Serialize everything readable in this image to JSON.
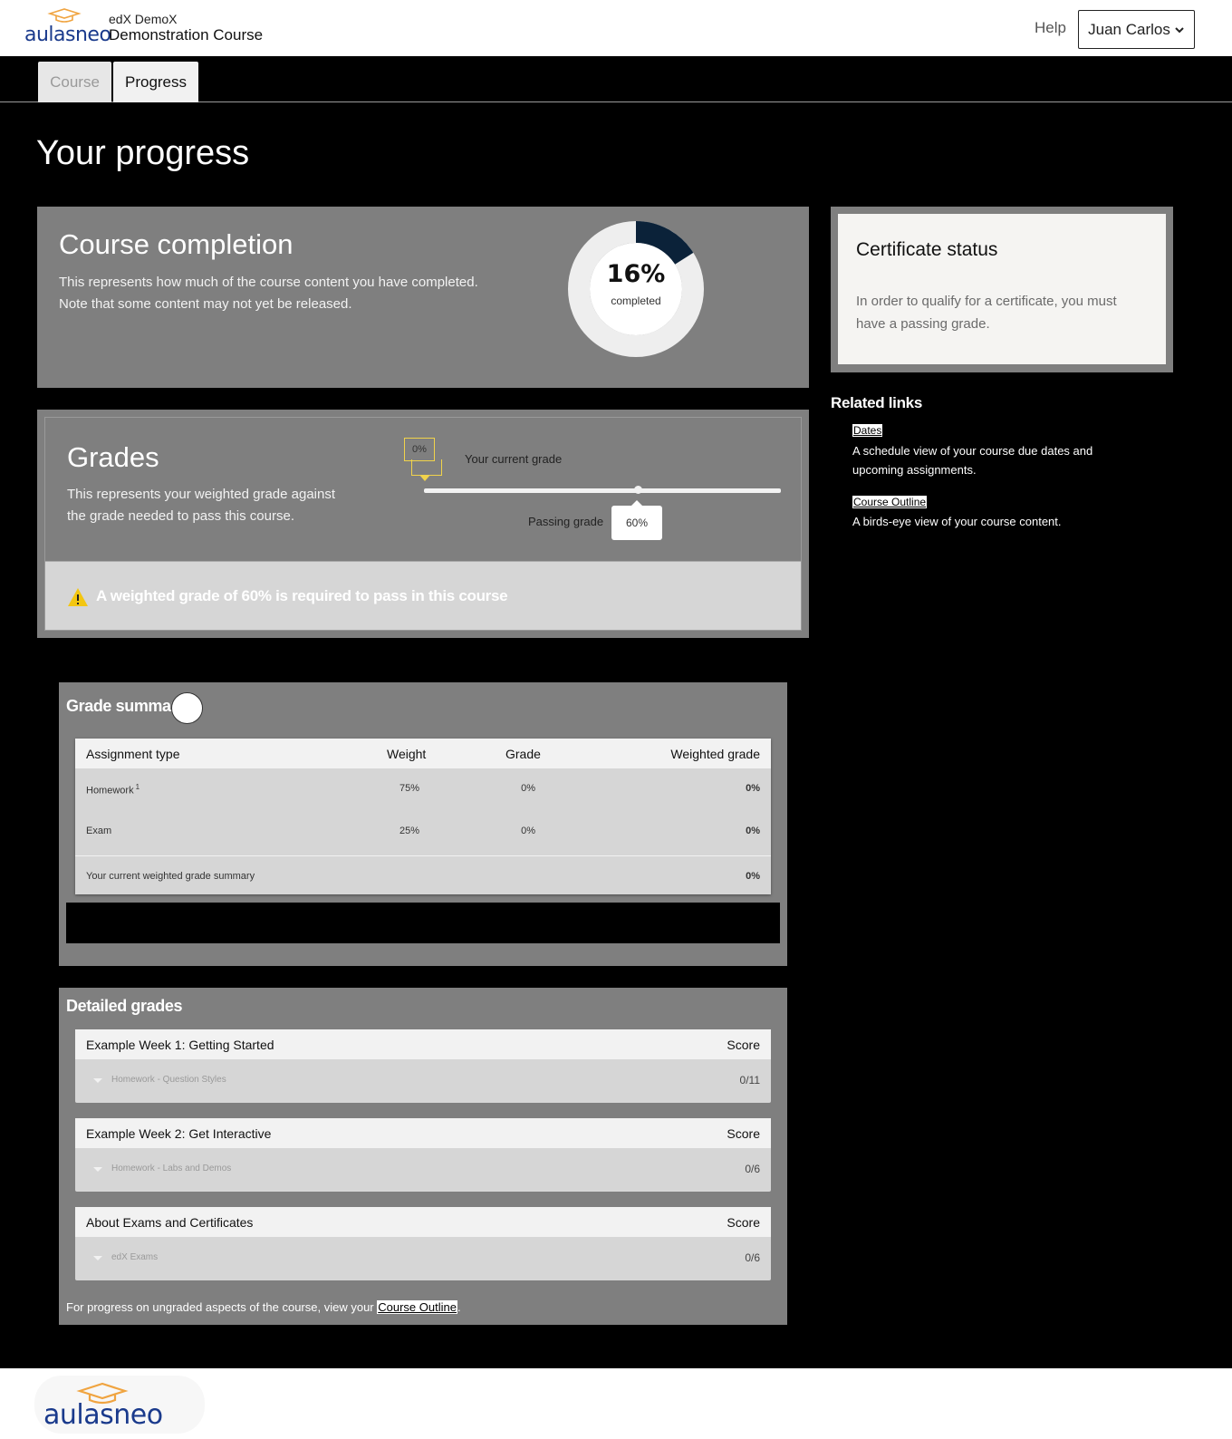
{
  "header": {
    "logo_text": "aulasneo",
    "course_org": "edX DemoX",
    "course_name": "Demonstration Course",
    "help_label": "Help",
    "user_name": "Juan Carlos"
  },
  "tabs": [
    {
      "label": "Course",
      "active": false
    },
    {
      "label": "Progress",
      "active": true
    }
  ],
  "page_title": "Your progress",
  "completion": {
    "title": "Course completion",
    "description": "This represents how much of the course content you have completed. Note that some content may not yet be released.",
    "percent": 16,
    "percent_label": "16%",
    "sub_label": "completed"
  },
  "certificate": {
    "title": "Certificate status",
    "description": "In order to qualify for a certificate, you must have a passing grade."
  },
  "related": {
    "title": "Related links",
    "links": [
      {
        "label": "Dates",
        "description": "A schedule view of your course due dates and upcoming assignments."
      },
      {
        "label": "Course Outline",
        "description": "A birds-eye view of your course content."
      }
    ]
  },
  "grades": {
    "title": "Grades",
    "description": "This represents your weighted grade against the grade needed to pass this course.",
    "current_grade_value": "0%",
    "current_grade_label": "Your current grade",
    "current_grade_fraction": 0.0,
    "passing_grade_label": "Passing grade",
    "passing_grade_value": "60%",
    "passing_grade_fraction": 0.6,
    "warning_text": "A weighted grade of 60% is required to pass in this course"
  },
  "summary": {
    "title": "Grade summary",
    "columns": [
      "Assignment type",
      "Weight",
      "Grade",
      "Weighted grade"
    ],
    "rows": [
      {
        "type": "Homework",
        "footnote": "1",
        "weight": "75%",
        "grade": "0%",
        "weighted": "0%"
      },
      {
        "type": "Exam",
        "footnote": "",
        "weight": "25%",
        "grade": "0%",
        "weighted": "0%"
      }
    ],
    "total_label": "Your current weighted grade summary",
    "total_value": "0%"
  },
  "detailed": {
    "title": "Detailed grades",
    "score_label": "Score",
    "sections": [
      {
        "title": "Example Week 1: Getting Started",
        "item": "Homework - Question Styles",
        "score": "0/11"
      },
      {
        "title": "Example Week 2: Get Interactive",
        "item": "Homework - Labs and Demos",
        "score": "0/6"
      },
      {
        "title": "About Exams and Certificates",
        "item": "edX Exams",
        "score": "0/6"
      }
    ],
    "footnote_prefix": "For progress on ungraded aspects of the course, view your ",
    "footnote_link": "Course Outline",
    "footnote_suffix": "."
  },
  "footer": {
    "logo_text": "aulasneo"
  },
  "colors": {
    "brand_blue": "#1a3a8c",
    "brand_orange": "#f0a440",
    "donut_fill": "#0b2239",
    "warning_yellow": "#f3c611",
    "panel_gray": "#7f7f7f"
  }
}
